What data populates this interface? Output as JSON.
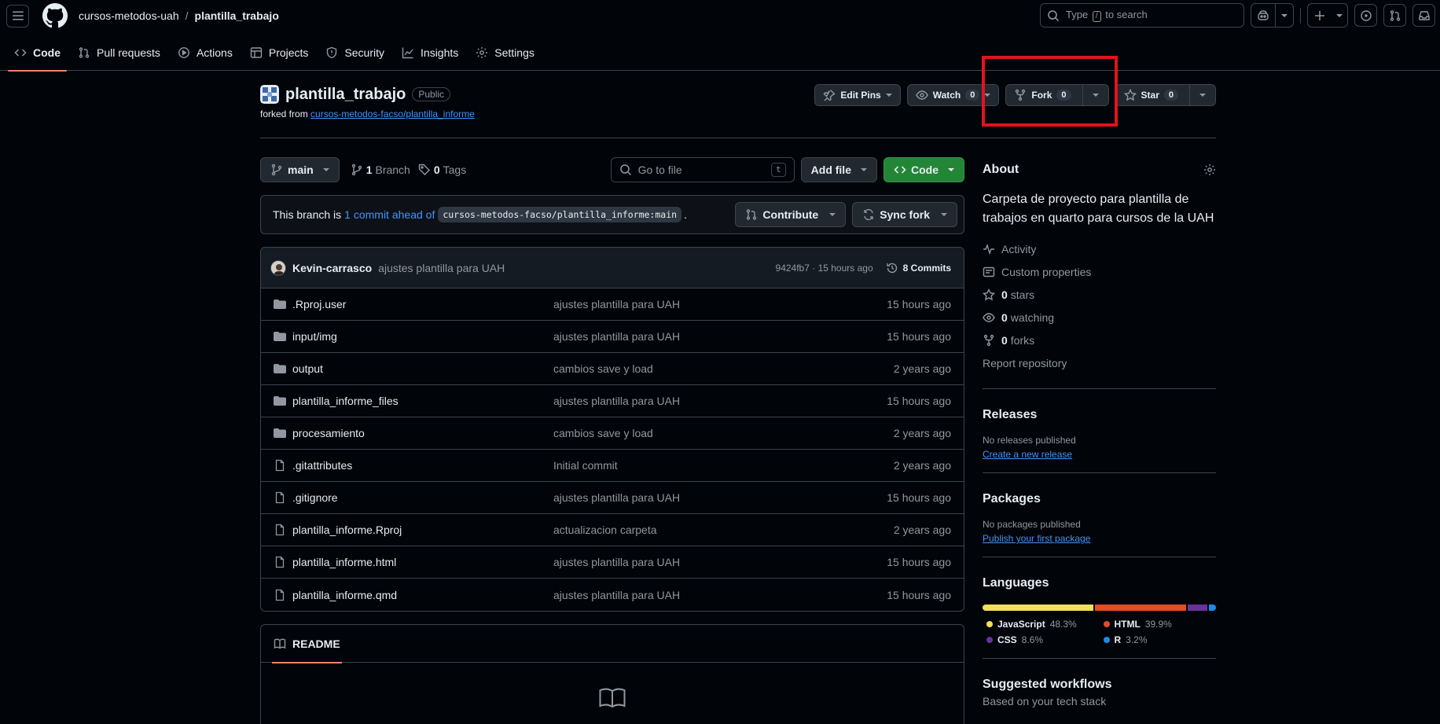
{
  "header": {
    "owner": "cursos-metodos-uah",
    "separator": "/",
    "repo": "plantilla_trabajo",
    "search_prefix": "Type",
    "search_key": "/",
    "search_suffix": "to search"
  },
  "tabs": [
    {
      "label": "Code",
      "icon": "code-icon"
    },
    {
      "label": "Pull requests",
      "icon": "git-pull-request-icon"
    },
    {
      "label": "Actions",
      "icon": "play-icon"
    },
    {
      "label": "Projects",
      "icon": "table-icon"
    },
    {
      "label": "Security",
      "icon": "shield-icon"
    },
    {
      "label": "Insights",
      "icon": "graph-icon"
    },
    {
      "label": "Settings",
      "icon": "gear-icon"
    }
  ],
  "repo": {
    "name": "plantilla_trabajo",
    "visibility": "Public",
    "forked_prefix": "forked from",
    "forked_from": "cursos-metodos-facso/plantilla_informe",
    "edit_pins": "Edit Pins",
    "watch": "Watch",
    "watch_count": "0",
    "fork": "Fork",
    "fork_count": "0",
    "star": "Star",
    "star_count": "0"
  },
  "filebar": {
    "branch": "main",
    "branches_count": "1",
    "branches_label": "Branch",
    "tags_count": "0",
    "tags_label": "Tags",
    "goto_placeholder": "Go to file",
    "goto_key": "t",
    "add_file": "Add file",
    "code": "Code"
  },
  "ahead": {
    "prefix": "This branch is",
    "link": "1 commit ahead of",
    "ref": "cursos-metodos-facso/plantilla_informe:main",
    "suffix": ".",
    "contribute": "Contribute",
    "sync": "Sync fork"
  },
  "latest_commit": {
    "author": "Kevin-carrasco",
    "message": "ajustes plantilla para UAH",
    "sha_time": "9424fb7 · 15 hours ago",
    "commits": "8 Commits"
  },
  "files": [
    {
      "type": "folder",
      "name": ".Rproj.user",
      "message": "ajustes plantilla para UAH",
      "time": "15 hours ago"
    },
    {
      "type": "folder",
      "name": "input/img",
      "message": "ajustes plantilla para UAH",
      "time": "15 hours ago"
    },
    {
      "type": "folder",
      "name": "output",
      "message": "cambios save y load",
      "time": "2 years ago"
    },
    {
      "type": "folder",
      "name": "plantilla_informe_files",
      "message": "ajustes plantilla para UAH",
      "time": "15 hours ago"
    },
    {
      "type": "folder",
      "name": "procesamiento",
      "message": "cambios save y load",
      "time": "2 years ago"
    },
    {
      "type": "file",
      "name": ".gitattributes",
      "message": "Initial commit",
      "time": "2 years ago"
    },
    {
      "type": "file",
      "name": ".gitignore",
      "message": "ajustes plantilla para UAH",
      "time": "15 hours ago"
    },
    {
      "type": "file",
      "name": "plantilla_informe.Rproj",
      "message": "actualizacion carpeta",
      "time": "2 years ago"
    },
    {
      "type": "file",
      "name": "plantilla_informe.html",
      "message": "ajustes plantilla para UAH",
      "time": "15 hours ago"
    },
    {
      "type": "file",
      "name": "plantilla_informe.qmd",
      "message": "ajustes plantilla para UAH",
      "time": "15 hours ago"
    }
  ],
  "readme": {
    "tab": "README"
  },
  "about": {
    "title": "About",
    "description": "Carpeta de proyecto para plantilla de trabajos en quarto para cursos de la UAH",
    "activity": "Activity",
    "custom_properties": "Custom properties",
    "stars_count": "0",
    "stars_label": "stars",
    "watching_count": "0",
    "watching_label": "watching",
    "forks_count": "0",
    "forks_label": "forks",
    "report": "Report repository"
  },
  "releases": {
    "title": "Releases",
    "empty": "No releases published",
    "link": "Create a new release"
  },
  "packages": {
    "title": "Packages",
    "empty": "No packages published",
    "link": "Publish your first package"
  },
  "languages": {
    "title": "Languages",
    "items": [
      {
        "name": "JavaScript",
        "pct": "48.3%",
        "value": 48.3,
        "color": "#f1e05a"
      },
      {
        "name": "HTML",
        "pct": "39.9%",
        "value": 39.9,
        "color": "#e34c26"
      },
      {
        "name": "CSS",
        "pct": "8.6%",
        "value": 8.6,
        "color": "#663399"
      },
      {
        "name": "R",
        "pct": "3.2%",
        "value": 3.2,
        "color": "#198ce7"
      }
    ]
  },
  "workflows": {
    "title": "Suggested workflows",
    "subtitle": "Based on your tech stack"
  },
  "colors": {
    "accent": "#f78166",
    "link": "#4493f8",
    "green": "#238636",
    "highlight": "#e0141e"
  }
}
